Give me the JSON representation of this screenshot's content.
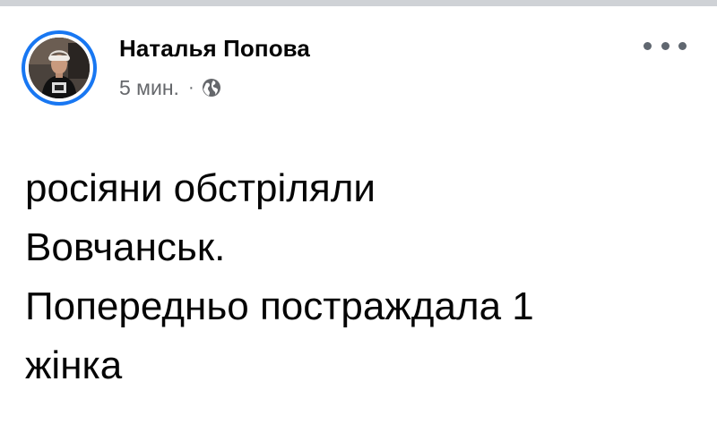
{
  "post": {
    "author": "Наталья Попова",
    "timestamp": "5 мин.",
    "separator": "·",
    "privacy_icon": "globe-icon",
    "more_icon": "more-options-icon",
    "text_lines": [
      "росіяни обстріляли",
      "Вовчанськ.",
      "Попередньо постраждала 1",
      "жінка"
    ]
  },
  "colors": {
    "avatar_ring": "#1877f2",
    "name": "#050505",
    "meta": "#65676b",
    "divider": "#cfd2d6"
  }
}
